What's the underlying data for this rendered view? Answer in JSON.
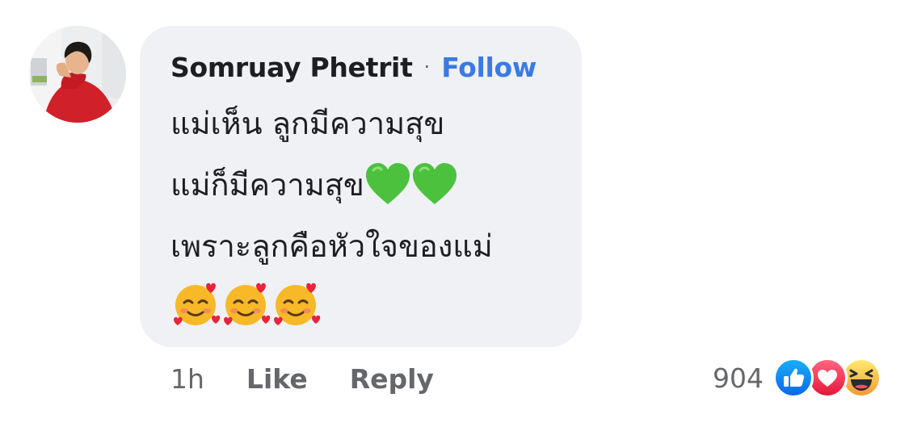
{
  "comment": {
    "author": "Somruay Phetrit",
    "separator": "·",
    "follow_label": "Follow",
    "lines": [
      "แม่เห็น ลูกมีความสุข",
      "แม่ก็มีความสุข",
      "เพราะลูกคือหัวใจของแม่"
    ],
    "line2_emojis": [
      "green-heart-icon",
      "green-heart-icon"
    ],
    "line4_emojis": [
      "smiling-face-with-hearts-icon",
      "smiling-face-with-hearts-icon",
      "smiling-face-with-hearts-icon"
    ]
  },
  "actions": {
    "timestamp": "1h",
    "like_label": "Like",
    "reply_label": "Reply"
  },
  "reactions": {
    "count": "904",
    "types": [
      "like-icon",
      "love-icon",
      "haha-icon"
    ]
  },
  "colors": {
    "bubble_bg": "#eff1f5",
    "follow_blue": "#3a7be3",
    "meta_gray": "#65676b",
    "like_blue": "#1877f2",
    "love_red": "#f33e58",
    "haha_yellow": "#f7b928",
    "green_heart": "#4cc13d"
  }
}
